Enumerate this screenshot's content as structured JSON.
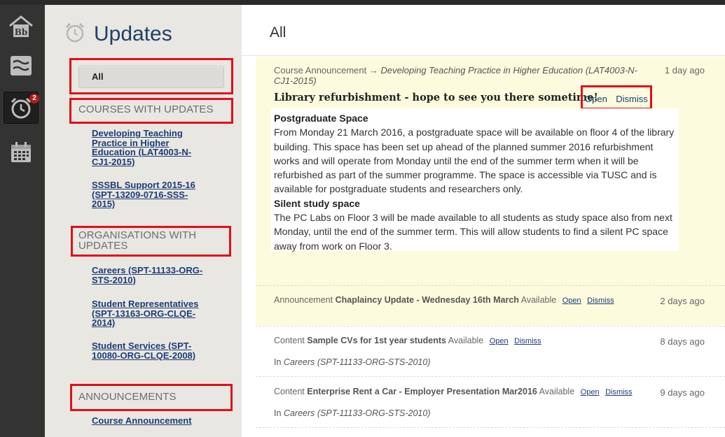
{
  "sidebar": {
    "title": "Updates",
    "all_label": "All",
    "sections": {
      "courses_heading": "COURSES WITH UPDATES",
      "orgs_heading": "ORGANISATIONS WITH UPDATES",
      "announcements_heading": "ANNOUNCEMENTS"
    },
    "courses": [
      "Developing Teaching Practice in Higher Education (LAT4003-N-CJ1-2015)",
      "SSSBL Support 2015-16 (SPT-13209-0716-SSS-2015)"
    ],
    "organisations": [
      "Careers (SPT-11133-ORG-STS-2010)",
      "Student Representatives (SPT-13163-ORG-CLQE-2014)",
      "Student Services (SPT-10080-ORG-CLQE-2008)"
    ],
    "announcements": [
      "Course Announcement"
    ]
  },
  "rail": {
    "badge_count": "2",
    "icons": [
      "blackboard-home-icon",
      "stream-icon",
      "updates-clock-icon",
      "calendar-icon"
    ]
  },
  "main": {
    "title": "All",
    "items": [
      {
        "type": "Course Announcement",
        "arrow": "→",
        "course": "Developing Teaching Practice in Higher Education (LAT4003-N-CJ1-2015)",
        "ago": "1 day ago",
        "title": "Library refurbishment - hope to see you there sometime!",
        "open": "Open",
        "dismiss": "Dismiss",
        "body": {
          "h1": "Postgraduate Space",
          "p1": "From Monday 21 March 2016, a postgraduate space will be available on floor 4 of the library building.  This space has been set up ahead of the planned summer 2016 refurbishment works and will operate from Monday until the end of the summer term when it will be refurbished as part of the summer programme.  The space is accessible via TUSC and is available for postgraduate students and researchers only.",
          "h2": "Silent study space",
          "p2": "The PC Labs on Floor 3 will be made available to all students as study space also from next Monday, until the end of the summer term.  This will allow students to find a silent PC space away from work on Floor 3."
        }
      },
      {
        "type": "Announcement",
        "title": "Chaplaincy Update - Wednesday 16th March",
        "status": "Available",
        "open": "Open",
        "dismiss": "Dismiss",
        "ago": "2 days ago"
      },
      {
        "type": "Content",
        "title": "Sample CVs for 1st year students",
        "status": "Available",
        "open": "Open",
        "dismiss": "Dismiss",
        "ago": "8 days ago",
        "in_prefix": "In",
        "in_course": "Careers (SPT-11133-ORG-STS-2010)"
      },
      {
        "type": "Content",
        "title": "Enterprise Rent a Car - Employer Presentation Mar2016",
        "status": "Available",
        "open": "Open",
        "dismiss": "Dismiss",
        "ago": "9 days ago",
        "in_prefix": "In",
        "in_course": "Careers (SPT-11133-ORG-STS-2010)"
      }
    ]
  },
  "colors": {
    "highlight": "#e0101a",
    "link": "#1c3c78",
    "unread_bg": "#fcfbde"
  }
}
